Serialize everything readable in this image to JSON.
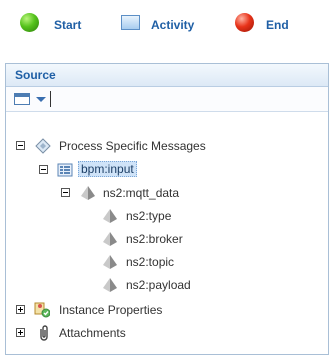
{
  "legend": {
    "start_label": "Start",
    "activity_label": "Activity",
    "end_label": "End"
  },
  "panel": {
    "title": "Source"
  },
  "tree": {
    "process_messages": "Process Specific Messages",
    "bpm_input": "bpm:input",
    "mqtt_data": "ns2:mqtt_data",
    "type": "ns2:type",
    "broker": "ns2:broker",
    "topic": "ns2:topic",
    "payload": "ns2:payload",
    "instance_properties": "Instance Properties",
    "attachments": "Attachments"
  },
  "colors": {
    "accent": "#1f5fa5",
    "selection": "#cfe3f8"
  },
  "icons": {
    "start": "green-circle-icon",
    "activity": "activity-box-icon",
    "end": "red-circle-icon",
    "toolbar": "window-icon",
    "messages": "diamond-message-icon",
    "input": "grid-icon",
    "element": "pyramid-icon",
    "instance": "properties-icon",
    "attachments": "paperclip-icon"
  }
}
